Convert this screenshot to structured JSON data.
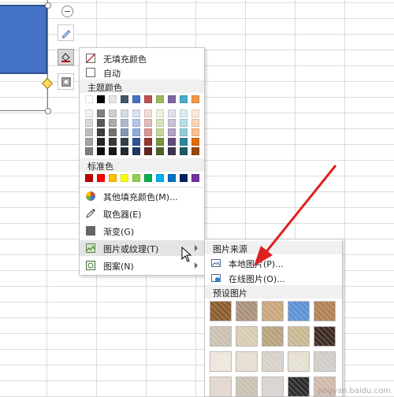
{
  "menu": {
    "no_fill": "无填充颜色",
    "auto": "自动",
    "theme_colors_title": "主题颜色",
    "standard_colors_title": "标准色",
    "more_fill_colors": "其他填充颜色(M)...",
    "eyedropper": "取色器(E)",
    "gradient": "渐变(G)",
    "picture_or_texture": "图片或纹理(T)",
    "pattern": "图案(N)"
  },
  "submenu": {
    "source_title": "图片来源",
    "local_picture": "本地图片(P)...",
    "online_picture": "在线图片(O)...",
    "preset_title": "预设图片"
  },
  "theme_colors": {
    "top_row": [
      "#ffffff",
      "#000000",
      "#e7e6e6",
      "#44546a",
      "#4472c4",
      "#c0504d",
      "#9bbb59",
      "#8064a2",
      "#4bacc6",
      "#f79646"
    ],
    "shades": [
      [
        "#f2f2f2",
        "#7f7f7f",
        "#d0cece",
        "#d6dce4",
        "#d9e2f3",
        "#f2dcdb",
        "#ebf1dd",
        "#e5e0ec",
        "#dbeef3",
        "#fde9d9"
      ],
      [
        "#d8d8d8",
        "#595959",
        "#aeaaaa",
        "#adb9ca",
        "#b4c6e7",
        "#e5b9b7",
        "#d7e3bc",
        "#ccc1d9",
        "#b7dde8",
        "#fbd5b5"
      ],
      [
        "#bfbfbf",
        "#3f3f3f",
        "#757070",
        "#8496b0",
        "#8eaadb",
        "#d99694",
        "#c3d69b",
        "#b2a2c7",
        "#92cddc",
        "#fac08f"
      ],
      [
        "#a5a5a5",
        "#262626",
        "#3a3838",
        "#323f4f",
        "#2f5496",
        "#953734",
        "#76923c",
        "#5f497a",
        "#31859b",
        "#e36c09"
      ],
      [
        "#7f7f7f",
        "#0c0c0c",
        "#171616",
        "#222a35",
        "#1f3864",
        "#632423",
        "#4f6128",
        "#3f3151",
        "#205867",
        "#974806"
      ]
    ]
  },
  "standard_colors": [
    "#c00000",
    "#ff0000",
    "#ffc000",
    "#ffff00",
    "#92d050",
    "#00b050",
    "#00b0f0",
    "#0070c0",
    "#002060",
    "#7030a0"
  ],
  "textures": [
    [
      "#8b5a2b",
      "#a89078",
      "#c8a57a",
      "#5b8fd6",
      "#b08050"
    ],
    [
      "#c9c0b0",
      "#d8cbb0",
      "#b5a27d",
      "#c8b890",
      "#3a2a20"
    ],
    [
      "#eee6da",
      "#e6ddd0",
      "#d8d0c8",
      "#e6e0d0",
      "#d0ccc8"
    ],
    [
      "#e2d6cf",
      "#c8c0b0",
      "#d8d2d0",
      "#2a2a2a",
      "#d0b8a8"
    ]
  ],
  "watermark": "jingyan.baidu.com"
}
